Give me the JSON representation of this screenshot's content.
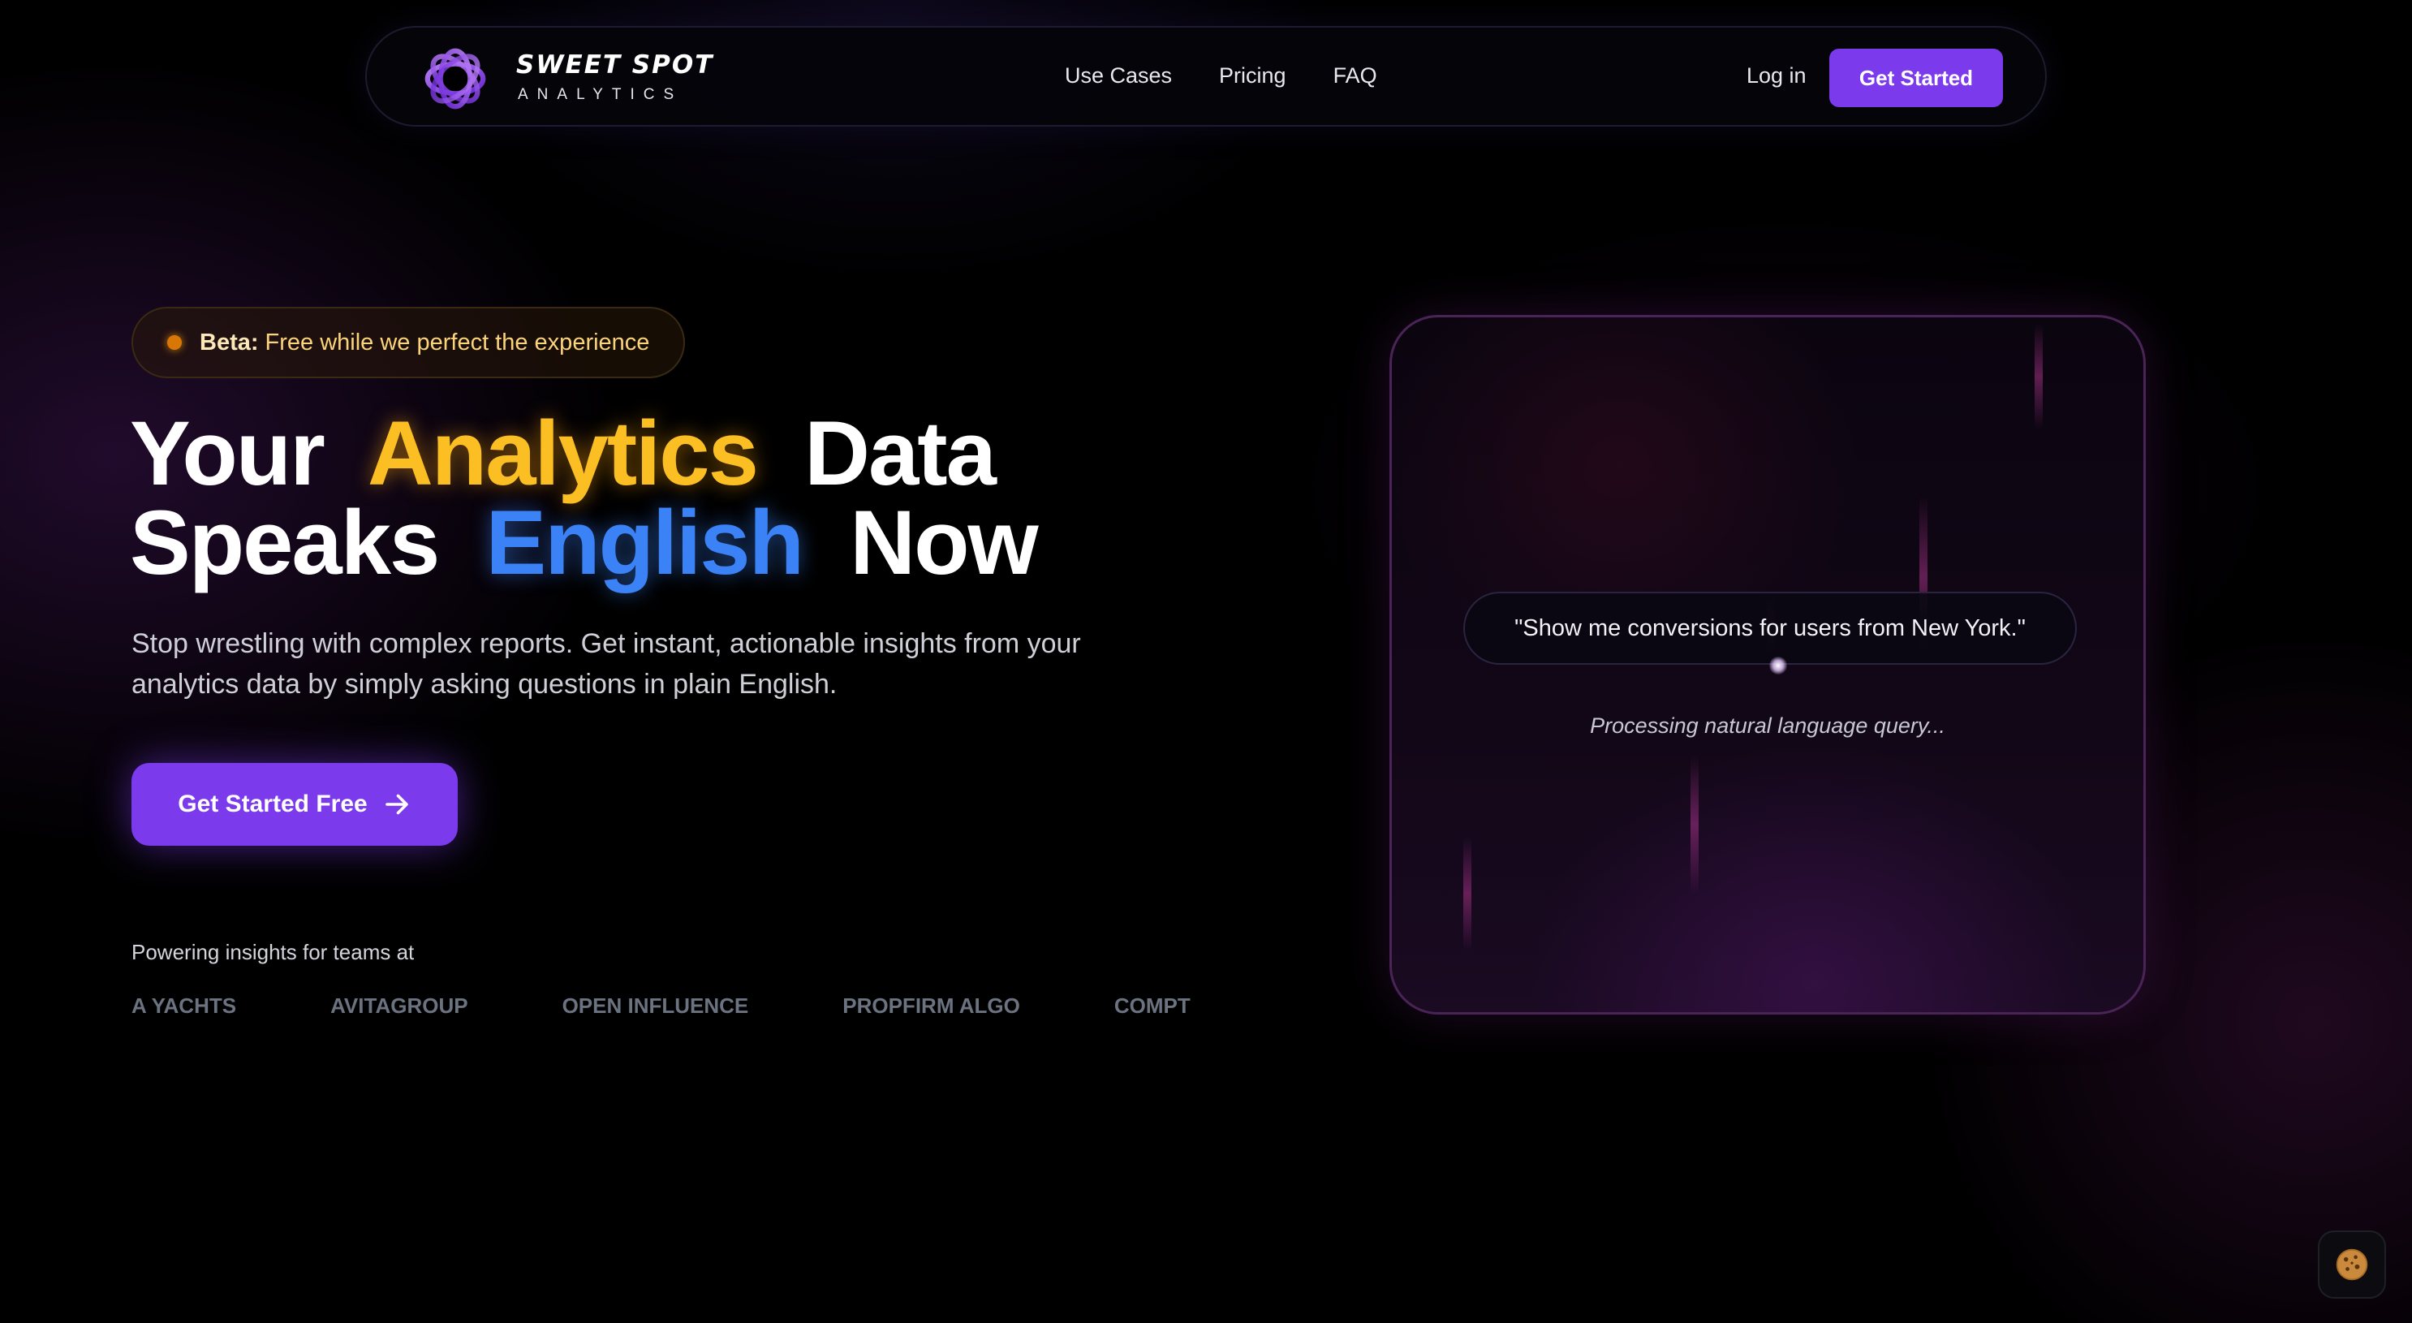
{
  "brand": {
    "name": "SWEET SPOT",
    "sub": "ANALYTICS",
    "logo_icon": "swirl-logo-icon"
  },
  "nav": {
    "links": [
      "Use Cases",
      "Pricing",
      "FAQ"
    ],
    "login": "Log in",
    "cta": "Get Started"
  },
  "hero": {
    "beta_label": "Beta:",
    "beta_text": "Free while we perfect the experience",
    "headline": {
      "w1": "Your",
      "w2": "Analytics",
      "w3": "Data",
      "w4": "Speaks",
      "w5": "English",
      "w6": "Now"
    },
    "subcopy": "Stop wrestling with complex reports. Get instant, actionable insights from your analytics data by simply asking questions in plain English.",
    "cta": "Get Started Free",
    "cta_icon": "arrow-right-icon"
  },
  "trust": {
    "label": "Powering insights for teams at",
    "clients": [
      "A YACHTS",
      "AVITAGROUP",
      "OPEN INFLUENCE",
      "PROPFIRM ALGO",
      "COMPT"
    ]
  },
  "demo": {
    "query": "\"Show me conversions for users from New York.\"",
    "status": "Processing natural language query..."
  },
  "cookie": {
    "icon": "cookie-icon"
  },
  "colors": {
    "accent": "#7c3aed",
    "headline_orange": "#fbbf24",
    "headline_blue": "#3b82f6",
    "beta_dot": "#d97706",
    "client_logo": "#6b7280"
  }
}
